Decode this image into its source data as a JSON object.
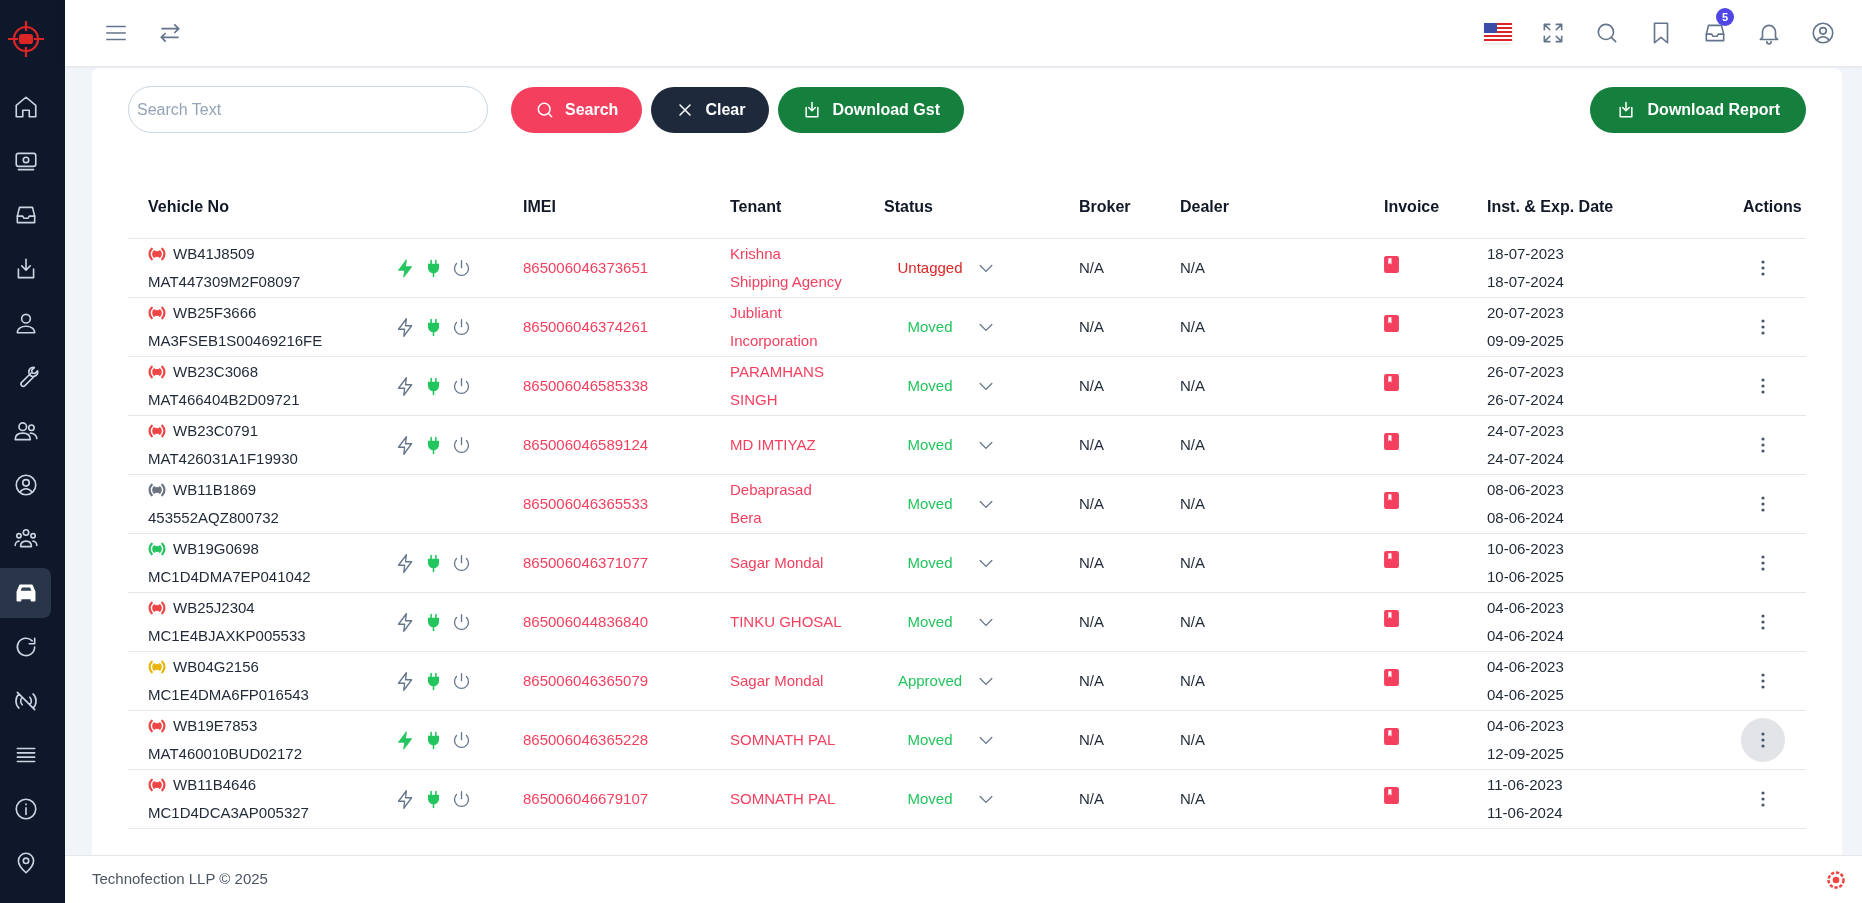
{
  "sidebar": {
    "items": [
      {
        "selected": false
      },
      {
        "selected": false
      },
      {
        "selected": false
      },
      {
        "selected": false
      },
      {
        "selected": false
      },
      {
        "selected": false
      },
      {
        "selected": false
      },
      {
        "selected": false
      },
      {
        "selected": false
      },
      {
        "selected": true
      },
      {
        "selected": false
      },
      {
        "selected": false
      },
      {
        "selected": false
      },
      {
        "selected": false
      },
      {
        "selected": false
      }
    ]
  },
  "topbar": {
    "notification_count": "5"
  },
  "toolbar": {
    "search": {
      "placeholder": "Search Text"
    },
    "buttons": [
      {
        "label": "Search",
        "kind": "search"
      },
      {
        "label": "Clear",
        "kind": "clear"
      },
      {
        "label": "Download Gst",
        "kind": "download"
      }
    ],
    "report_button": {
      "label": "Download Report"
    }
  },
  "table": {
    "columns": [
      "Vehicle No",
      "IMEI",
      "Tenant",
      "Status",
      "Broker",
      "Dealer",
      "Invoice",
      "Inst. & Exp. Date",
      "Actions"
    ],
    "rows": [
      {
        "vehicle_no": "WB41J8509",
        "chassis_no": "MAT447309M2F08097",
        "color": "#ef4444",
        "device_icons": true,
        "charging": true,
        "imei": "865006046373651",
        "tenant": "Krishna Shipping Agency",
        "status": "Untagged",
        "kind": "untagged",
        "broker": "N/A",
        "dealer": "N/A",
        "install_date": "18-07-2023",
        "expiry_date": "18-07-2024",
        "actions_hovered": false
      },
      {
        "vehicle_no": "WB25F3666",
        "chassis_no": "MA3FSEB1S00469216FE",
        "color": "#ef4444",
        "device_icons": true,
        "charging": false,
        "imei": "865006046374261",
        "tenant": "Jubliant Incorporation",
        "status": "Moved",
        "kind": "moved",
        "broker": "N/A",
        "dealer": "N/A",
        "install_date": "20-07-2023",
        "expiry_date": "09-09-2025",
        "actions_hovered": false
      },
      {
        "vehicle_no": "WB23C3068",
        "chassis_no": "MAT466404B2D09721",
        "color": "#ef4444",
        "device_icons": true,
        "charging": false,
        "imei": "865006046585338",
        "tenant": "PARAMHANS SINGH",
        "status": "Moved",
        "kind": "moved",
        "broker": "N/A",
        "dealer": "N/A",
        "install_date": "26-07-2023",
        "expiry_date": "26-07-2024",
        "actions_hovered": false
      },
      {
        "vehicle_no": "WB23C0791",
        "chassis_no": "MAT426031A1F19930",
        "color": "#ef4444",
        "device_icons": true,
        "charging": false,
        "imei": "865006046589124",
        "tenant": "MD IMTIYAZ",
        "status": "Moved",
        "kind": "moved",
        "broker": "N/A",
        "dealer": "N/A",
        "install_date": "24-07-2023",
        "expiry_date": "24-07-2024",
        "actions_hovered": false
      },
      {
        "vehicle_no": "WB11B1869",
        "chassis_no": "453552AQZ800732",
        "color": "#6b7280",
        "device_icons": false,
        "imei": "865006046365533",
        "tenant": "Debaprasad Bera",
        "status": "Moved",
        "kind": "moved",
        "broker": "N/A",
        "dealer": "N/A",
        "install_date": "08-06-2023",
        "expiry_date": "08-06-2024",
        "actions_hovered": false
      },
      {
        "vehicle_no": "WB19G0698",
        "chassis_no": "MC1D4DMA7EP041042",
        "color": "#22c55e",
        "device_icons": true,
        "charging": false,
        "imei": "865006046371077",
        "tenant": "Sagar Mondal",
        "status": "Moved",
        "kind": "moved",
        "broker": "N/A",
        "dealer": "N/A",
        "install_date": "10-06-2023",
        "expiry_date": "10-06-2025",
        "actions_hovered": false
      },
      {
        "vehicle_no": "WB25J2304",
        "chassis_no": "MC1E4BJAXKP005533",
        "color": "#ef4444",
        "device_icons": true,
        "charging": false,
        "imei": "865006044836840",
        "tenant": "TINKU GHOSAL",
        "status": "Moved",
        "kind": "moved",
        "broker": "N/A",
        "dealer": "N/A",
        "install_date": "04-06-2023",
        "expiry_date": "04-06-2024",
        "actions_hovered": false
      },
      {
        "vehicle_no": "WB04G2156",
        "chassis_no": "MC1E4DMA6FP016543",
        "color": "#eab308",
        "device_icons": true,
        "charging": false,
        "imei": "865006046365079",
        "tenant": "Sagar Mondal",
        "status": "Approved",
        "kind": "approved",
        "broker": "N/A",
        "dealer": "N/A",
        "install_date": "04-06-2023",
        "expiry_date": "04-06-2025",
        "actions_hovered": false
      },
      {
        "vehicle_no": "WB19E7853",
        "chassis_no": "MAT460010BUD02172",
        "color": "#ef4444",
        "device_icons": true,
        "charging": true,
        "imei": "865006046365228",
        "tenant": "SOMNATH PAL",
        "status": "Moved",
        "kind": "moved",
        "broker": "N/A",
        "dealer": "N/A",
        "install_date": "04-06-2023",
        "expiry_date": "12-09-2025",
        "actions_hovered": true
      },
      {
        "vehicle_no": "WB11B4646",
        "chassis_no": "MC1D4DCA3AP005327",
        "color": "#ef4444",
        "device_icons": true,
        "charging": false,
        "imei": "865006046679107",
        "tenant": "SOMNATH PAL",
        "status": "Moved",
        "kind": "moved",
        "broker": "N/A",
        "dealer": "N/A",
        "install_date": "11-06-2023",
        "expiry_date": "11-06-2024",
        "actions_hovered": false
      }
    ]
  },
  "footer": {
    "text": "Technofection LLP © 2025"
  }
}
